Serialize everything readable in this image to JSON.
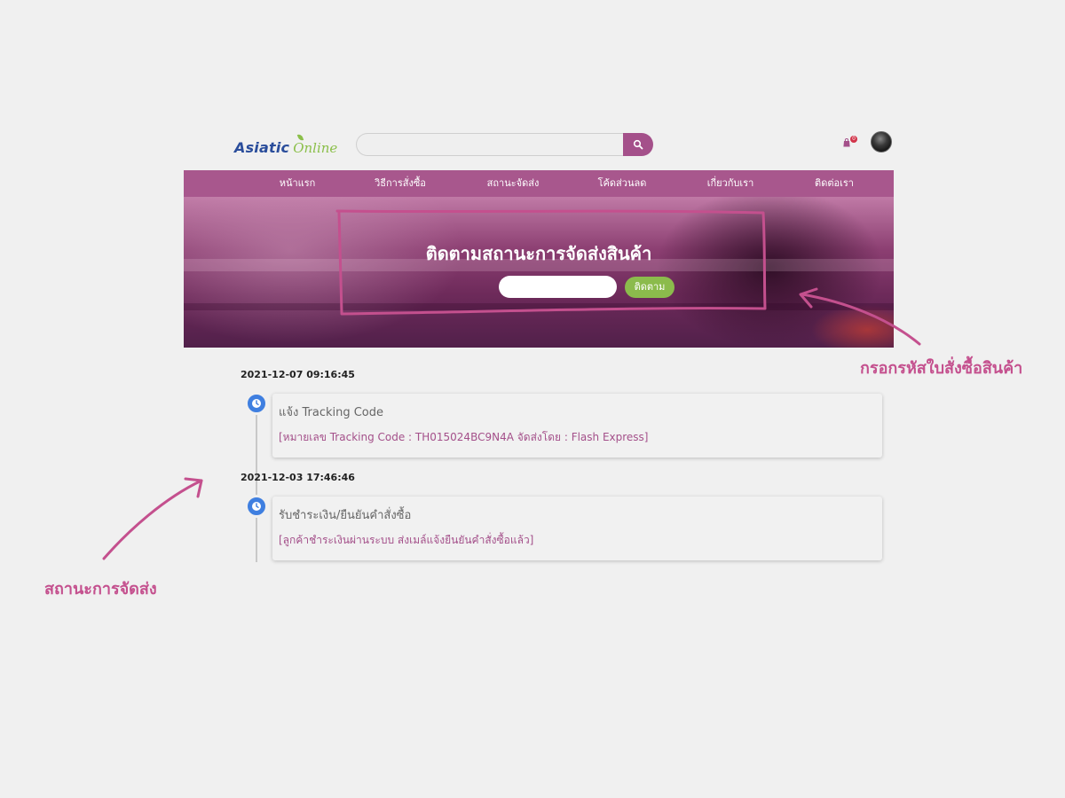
{
  "header": {
    "logo_part1": "Asiatic",
    "logo_part2": "Online",
    "search_placeholder": "",
    "cart_count": "0"
  },
  "nav": {
    "items": [
      "หน้าแรก",
      "วิธีการสั่งซื้อ",
      "สถานะจัดส่ง",
      "โค้ดส่วนลด",
      "เกี่ยวกับเรา",
      "ติดต่อเรา"
    ]
  },
  "hero": {
    "title": "ติดตามสถานะการจัดส่งสินค้า",
    "input_placeholder": "",
    "button_label": "ติดตาม"
  },
  "timeline": [
    {
      "timestamp": "2021-12-07 09:16:45",
      "title": "แจ้ง Tracking Code",
      "detail": "[หมายเลข Tracking Code : TH015024BC9N4A จัดส่งโดย : Flash Express]"
    },
    {
      "timestamp": "2021-12-03 17:46:46",
      "title": "รับชำระเงิน/ยืนยันคำสั่งซื้อ",
      "detail": "[ลูกค้าชำระเงินผ่านระบบ ส่งเมล์แจ้งยืนยันคำสั่งซื้อแล้ว]"
    }
  ],
  "annotations": {
    "right_label": "กรอกรหัสใบสั่งซื้อสินค้า",
    "left_label": "สถานะการจัดส่ง",
    "color": "#c4508e"
  },
  "colors": {
    "brand_purple": "#a8578d",
    "accent_green": "#8bbb4c",
    "logo_blue": "#2a4d9b",
    "timeline_dot": "#3f7fe0"
  }
}
